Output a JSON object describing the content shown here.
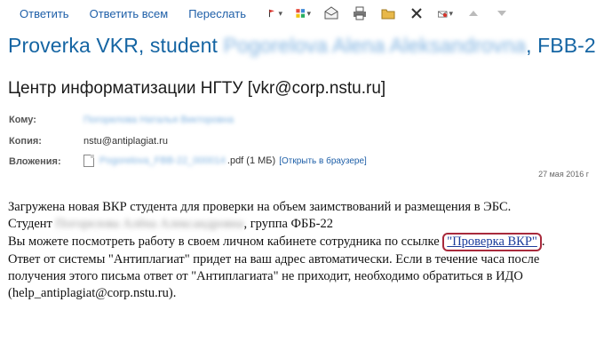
{
  "toolbar": {
    "reply": "Ответить",
    "reply_all": "Ответить всем",
    "forward": "Переслать",
    "icons": [
      "flag-icon",
      "categories-icon",
      "mark-read-icon",
      "print-icon",
      "move-folder-icon",
      "delete-icon",
      "junk-icon",
      "up-icon",
      "down-icon"
    ]
  },
  "message": {
    "subject_prefix": "Proverka VKR, student ",
    "subject_name": "Pogorelova Alena Aleksandrovna",
    "subject_suffix": ", FBB-2",
    "sender": "Центр информатизации НГТУ [vkr@corp.nstu.ru]",
    "to_label": "Кому:",
    "to_value": "Погорелова Наталья Викторовна",
    "cc_label": "Копия:",
    "cc_value": "nstu@antiplagiat.ru",
    "attachments_label": "Вложения:",
    "attachment_name": "Pogorelova_FBB-22_000014",
    "attachment_ext": ".pdf (1 МБ)",
    "attachment_open": "[Открыть в браузере]",
    "date": "27 мая 2016 г"
  },
  "body": {
    "line1": "Загружена новая ВКР студента для проверки на объем заимствований и размещения в ЭБС.",
    "line2_prefix": "Студент ",
    "line2_name": "Погорелова Алёна Александровна",
    "line2_suffix": ", группа ФББ-22",
    "line3_prefix": "Вы можете посмотреть работу в своем личном кабинете сотрудника по ссылке ",
    "link_text": "\"Проверка ВКР\"",
    "line3_suffix": ".",
    "line4": "Ответ от системы \"Антиплагиат\" придет на ваш адрес автоматически. Если в течение часа после",
    "line5": "получения этого письма ответ от \"Антиплагиата\" не приходит, необходимо обратиться в ИДО",
    "line6": "(help_antiplagiat@corp.nstu.ru)."
  }
}
